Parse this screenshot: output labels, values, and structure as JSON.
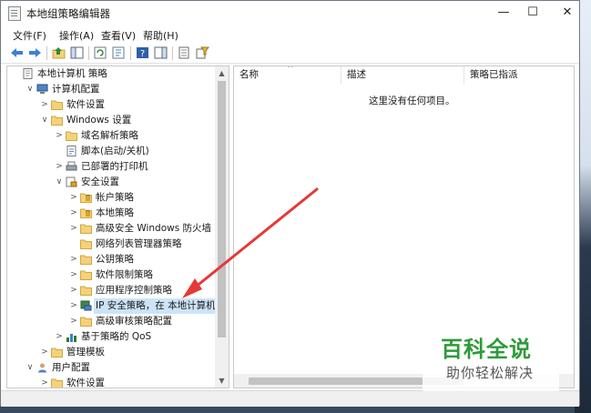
{
  "window": {
    "title": "本地组策略编辑器",
    "controls": [
      "—",
      "☐",
      "✕"
    ]
  },
  "menu": [
    "文件(F)",
    "操作(A)",
    "查看(V)",
    "帮助(H)"
  ],
  "tree": {
    "nodes": [
      {
        "label": "本地计算机 策略",
        "depth": 0,
        "toggle": "",
        "icon": "policy-doc-icon"
      },
      {
        "label": "计算机配置",
        "depth": 1,
        "toggle": "∨",
        "icon": "computer-config-icon"
      },
      {
        "label": "软件设置",
        "depth": 2,
        "toggle": ">",
        "icon": "folder-icon"
      },
      {
        "label": "Windows 设置",
        "depth": 2,
        "toggle": "∨",
        "icon": "folder-icon"
      },
      {
        "label": "域名解析策略",
        "depth": 3,
        "toggle": ">",
        "icon": "folder-icon"
      },
      {
        "label": "脚本(启动/关机)",
        "depth": 3,
        "toggle": "",
        "icon": "script-icon"
      },
      {
        "label": "已部署的打印机",
        "depth": 3,
        "toggle": ">",
        "icon": "printer-icon"
      },
      {
        "label": "安全设置",
        "depth": 3,
        "toggle": "∨",
        "icon": "security-settings-icon"
      },
      {
        "label": "帐户策略",
        "depth": 4,
        "toggle": ">",
        "icon": "lock-folder-icon"
      },
      {
        "label": "本地策略",
        "depth": 4,
        "toggle": ">",
        "icon": "lock-folder-icon"
      },
      {
        "label": "高级安全 Windows 防火墙",
        "depth": 4,
        "toggle": ">",
        "icon": "folder-icon"
      },
      {
        "label": "网络列表管理器策略",
        "depth": 4,
        "toggle": "",
        "icon": "folder-icon"
      },
      {
        "label": "公钥策略",
        "depth": 4,
        "toggle": ">",
        "icon": "folder-icon"
      },
      {
        "label": "软件限制策略",
        "depth": 4,
        "toggle": ">",
        "icon": "folder-icon"
      },
      {
        "label": "应用程序控制策略",
        "depth": 4,
        "toggle": ">",
        "icon": "folder-icon"
      },
      {
        "label": "IP 安全策略，在 本地计算机",
        "depth": 4,
        "toggle": ">",
        "icon": "ip-security-icon",
        "selected": true
      },
      {
        "label": "高级审核策略配置",
        "depth": 4,
        "toggle": ">",
        "icon": "folder-icon"
      },
      {
        "label": "基于策略的 QoS",
        "depth": 3,
        "toggle": ">",
        "icon": "qos-chart-icon"
      },
      {
        "label": "管理模板",
        "depth": 2,
        "toggle": ">",
        "icon": "folder-icon"
      },
      {
        "label": "用户配置",
        "depth": 1,
        "toggle": "∨",
        "icon": "user-config-icon"
      },
      {
        "label": "软件设置",
        "depth": 2,
        "toggle": ">",
        "icon": "folder-icon"
      }
    ]
  },
  "list": {
    "columns": [
      "名称",
      "描述",
      "策略已指派"
    ],
    "sort_indicator": "^",
    "empty_message": "这里没有任何项目。"
  },
  "watermark": {
    "logo": "百科全说",
    "tagline": "助你轻松解决"
  },
  "colors": {
    "annotation_arrow": "#e53935",
    "watermark_green": "#2e9a3a",
    "selection": "#cce4f7"
  }
}
